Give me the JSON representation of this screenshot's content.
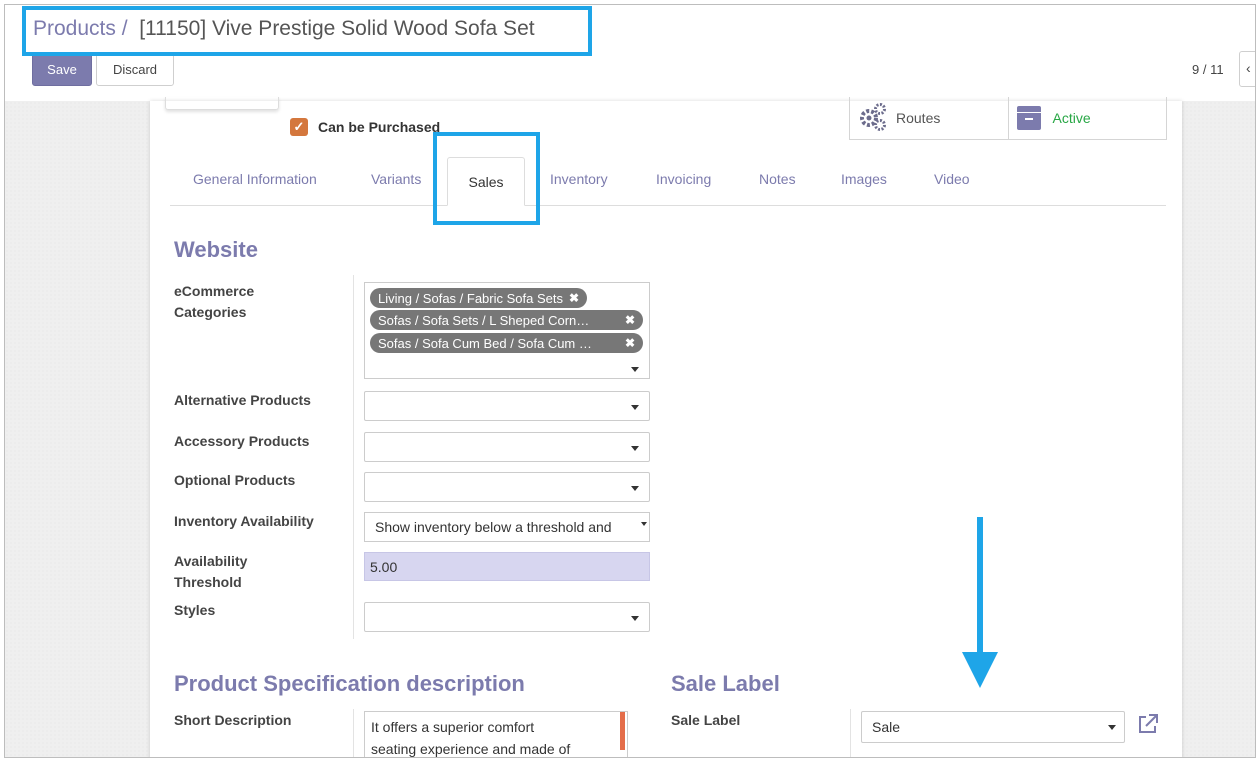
{
  "breadcrumb": {
    "parent": "Products /",
    "current": "[11150] Vive Prestige Solid Wood Sofa Set"
  },
  "buttons": {
    "save": "Save",
    "discard": "Discard"
  },
  "pager": {
    "value": "9 / 11",
    "prev": "‹"
  },
  "purchase": {
    "check": "✓",
    "label": "Can be Purchased"
  },
  "smart_buttons": {
    "routes": "Routes",
    "active": "Active",
    "routes_icon": "gears-icon",
    "active_icon": "archive-icon"
  },
  "tabs": [
    "General Information",
    "Variants",
    "Sales",
    "Inventory",
    "Invoicing",
    "Notes",
    "Images",
    "Video"
  ],
  "website": {
    "title": "Website",
    "ecommerce_label_1": "eCommerce",
    "ecommerce_label_2": "Categories",
    "categories": [
      "Living / Sofas / Fabric Sofa Sets",
      "Sofas / Sofa Sets / L Sheped Corn…",
      "Sofas / Sofa Cum Bed / Sofa Cum …"
    ],
    "remove_glyph": "✖",
    "alternative_label": "Alternative Products",
    "accessory_label": "Accessory Products",
    "optional_label": "Optional Products",
    "inventory_label": "Inventory Availability",
    "inventory_value": "Show inventory below a threshold and",
    "threshold_label_1": "Availability",
    "threshold_label_2": "Threshold",
    "threshold_value": "5.00",
    "styles_label": "Styles"
  },
  "spec": {
    "title": "Product Specification description",
    "short_label": "Short Description",
    "short_value_1": "It offers a superior comfort",
    "short_value_2": "seating experience and made of"
  },
  "sale_label": {
    "title": "Sale Label",
    "field_label": "Sale Label",
    "value": "Sale"
  },
  "colors": {
    "accent": "#7c7bad",
    "annotation": "#1ea5e8",
    "active": "#28a745",
    "checkbox": "#d4773d"
  }
}
